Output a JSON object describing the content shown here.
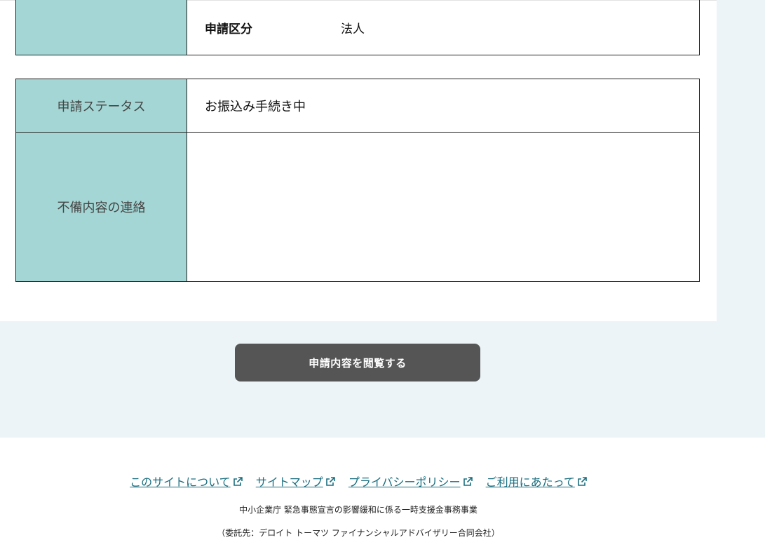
{
  "applicant": {
    "type_label": "申請区分",
    "type_value": "法人"
  },
  "status": {
    "label": "申請ステータス",
    "value": "お振込み手続き中"
  },
  "deficiency": {
    "label": "不備内容の連絡",
    "value": ""
  },
  "actions": {
    "view_application_label": "申請内容を閲覧する"
  },
  "footer": {
    "links": [
      {
        "label": "このサイトについて",
        "icon": "external-link-icon"
      },
      {
        "label": "サイトマップ",
        "icon": "external-link-icon"
      },
      {
        "label": "プライバシーポリシー",
        "icon": "external-link-icon"
      },
      {
        "label": "ご利用にあたって",
        "icon": "external-link-icon"
      }
    ],
    "organization": "中小企業庁 緊急事態宣言の影響緩和に係る一時支援金事務事業",
    "contractor": "（委託先：デロイト トーマツ ファイナンシャルアドバイザリー合同会社）"
  },
  "colors": {
    "label_bg": "#a3d6d4",
    "band_bg": "#edf4f7",
    "button_bg": "#555555",
    "link": "#1a6e80"
  }
}
